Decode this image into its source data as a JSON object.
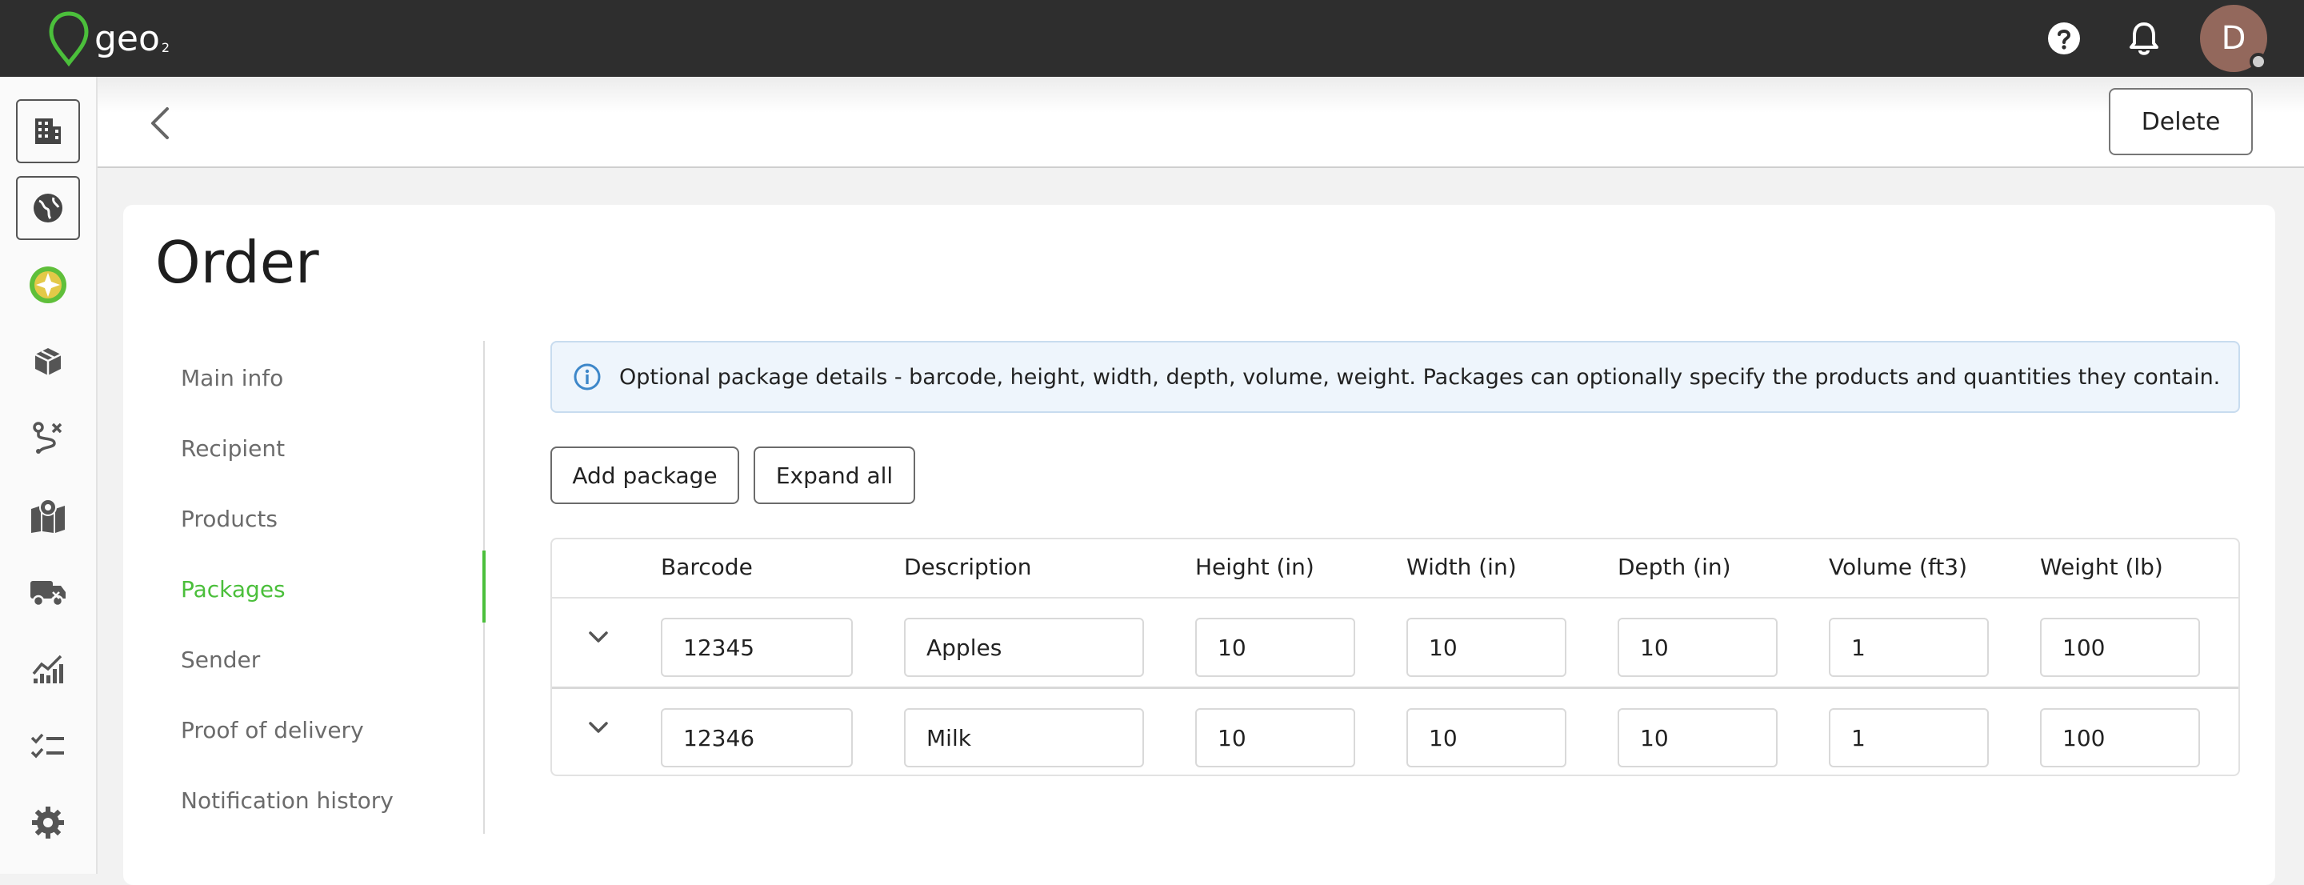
{
  "brand": {
    "name": "geo",
    "sub": "2",
    "accent": "#4bbf3b"
  },
  "topbar": {
    "help_icon": "help-circle-icon",
    "notifications_icon": "bell-icon",
    "avatar_initial": "D"
  },
  "rail": {
    "items": [
      {
        "icon": "building-icon"
      },
      {
        "icon": "globe-icon"
      },
      {
        "icon": "star-badge-icon"
      },
      {
        "icon": "package-icon"
      },
      {
        "icon": "route-icon"
      },
      {
        "icon": "map-pin-icon"
      },
      {
        "icon": "delivery-truck-icon"
      },
      {
        "icon": "analytics-icon"
      },
      {
        "icon": "checklist-icon"
      },
      {
        "icon": "gear-icon"
      }
    ]
  },
  "header": {
    "delete_label": "Delete"
  },
  "page": {
    "title": "Order"
  },
  "subnav": {
    "items": [
      {
        "label": "Main info"
      },
      {
        "label": "Recipient"
      },
      {
        "label": "Products"
      },
      {
        "label": "Packages"
      },
      {
        "label": "Sender"
      },
      {
        "label": "Proof of delivery"
      },
      {
        "label": "Notification history"
      }
    ],
    "active": "Packages"
  },
  "info": {
    "text": "Optional package details - barcode, height, width, depth, volume, weight. Packages can optionally specify the products and quantities they contain."
  },
  "actions": {
    "add_package": "Add package",
    "expand_all": "Expand all"
  },
  "table": {
    "headers": {
      "barcode": "Barcode",
      "description": "Description",
      "height": "Height (in)",
      "width": "Width (in)",
      "depth": "Depth (in)",
      "volume": "Volume (ft3)",
      "weight": "Weight (lb)"
    },
    "rows": [
      {
        "barcode": "12345",
        "description": "Apples",
        "height": "10",
        "width": "10",
        "depth": "10",
        "volume": "1",
        "weight": "100"
      },
      {
        "barcode": "12346",
        "description": "Milk",
        "height": "10",
        "width": "10",
        "depth": "10",
        "volume": "1",
        "weight": "100"
      }
    ]
  }
}
